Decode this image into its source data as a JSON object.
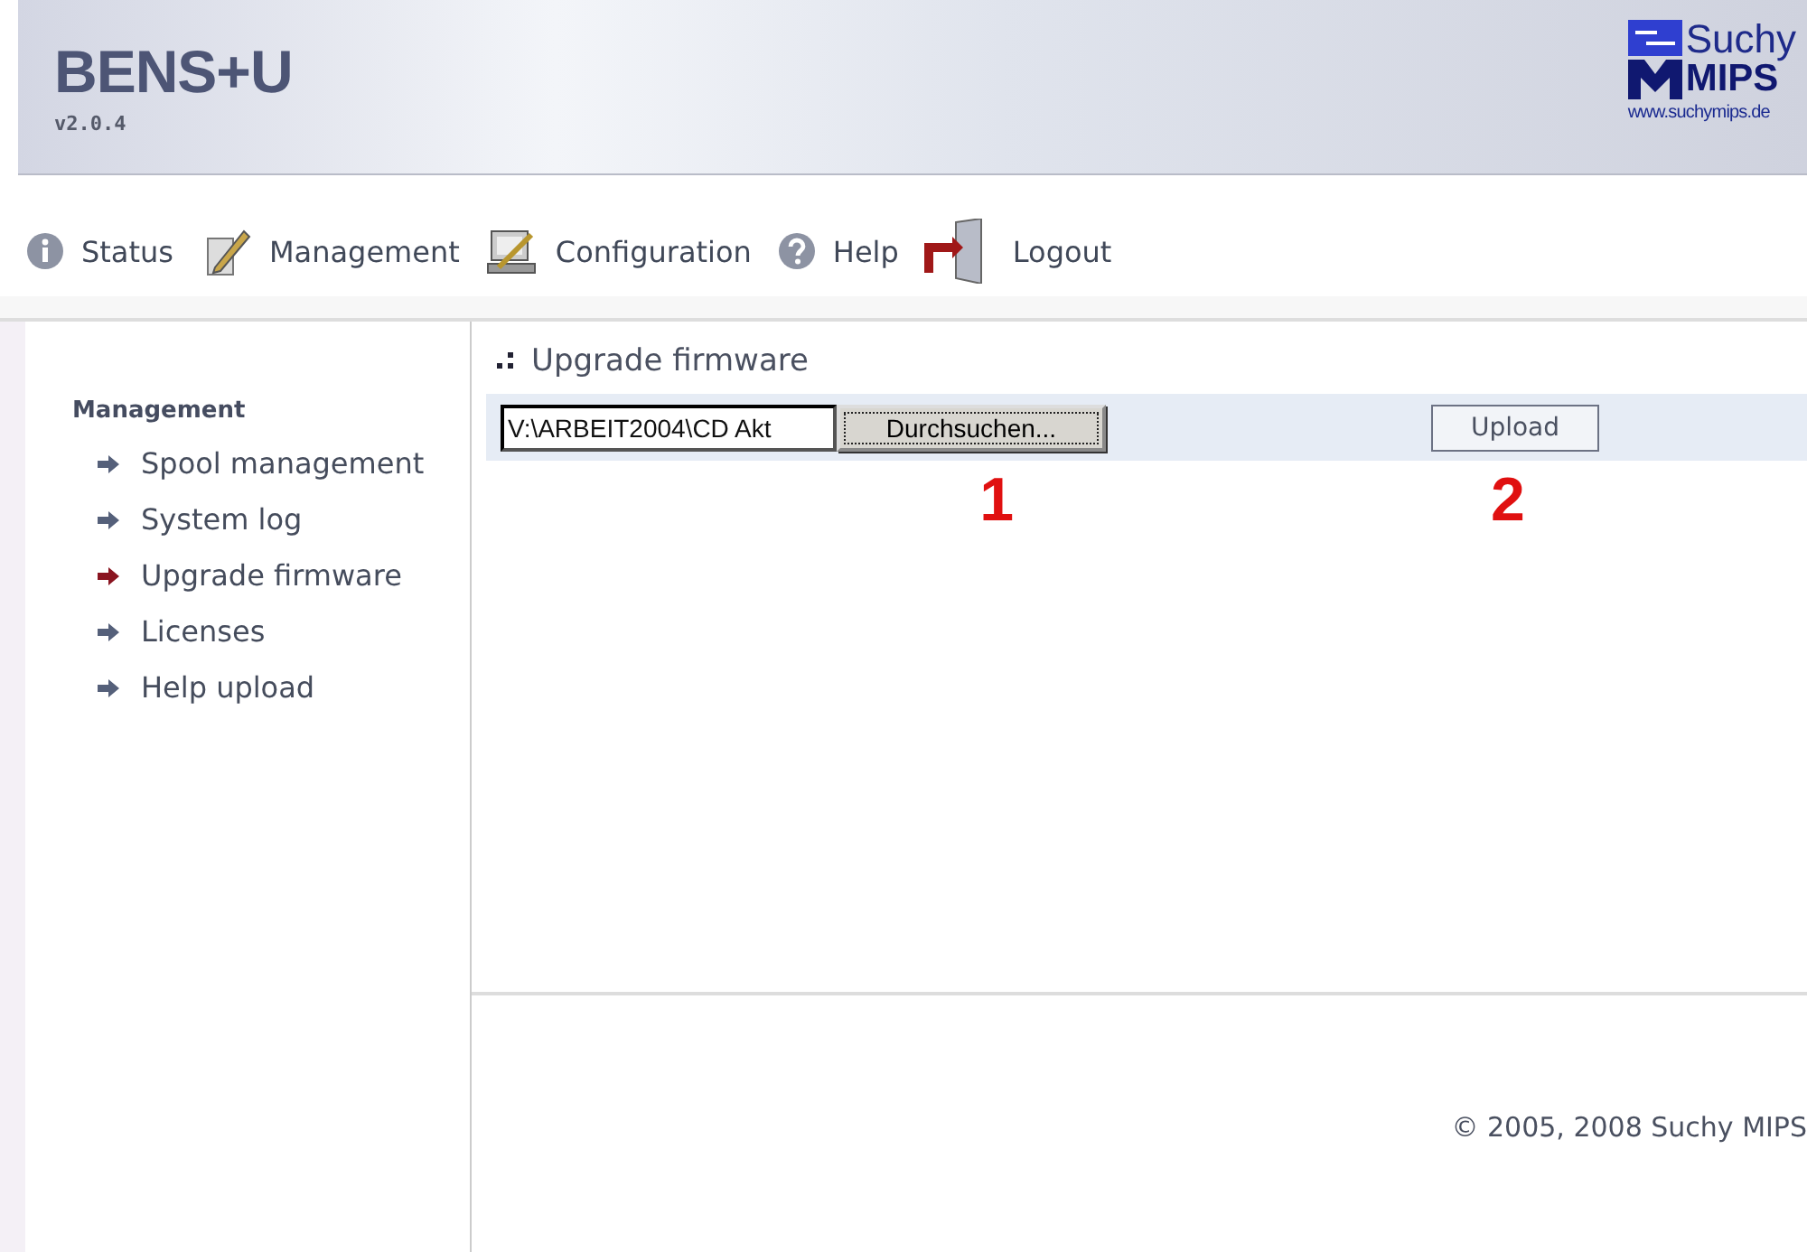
{
  "header": {
    "product": "BENS+U",
    "version": "v2.0.4",
    "logo_top": "Suchy",
    "logo_bottom": "MIPS",
    "logo_url": "www.suchymips.de"
  },
  "nav": [
    {
      "label": "Status",
      "kind": "info"
    },
    {
      "label": "Management",
      "kind": "pencil"
    },
    {
      "label": "Configuration",
      "kind": "config"
    },
    {
      "label": "Help",
      "kind": "help"
    },
    {
      "label": "Logout",
      "kind": "door"
    }
  ],
  "sidebar": {
    "heading": "Management",
    "items": [
      {
        "label": "Spool management",
        "selected": false
      },
      {
        "label": "System log",
        "selected": false
      },
      {
        "label": "Upgrade firmware",
        "selected": true
      },
      {
        "label": "Licenses",
        "selected": false
      },
      {
        "label": "Help upload",
        "selected": false
      }
    ]
  },
  "content": {
    "title": "Upgrade firmware",
    "file_value": "V:\\ARBEIT2004\\CD Akt",
    "browse_button": "Durchsuchen...",
    "upload_button": "Upload",
    "marker_1": "1",
    "marker_2": "2"
  },
  "footer": "© 2005, 2008 Suchy MIPS"
}
